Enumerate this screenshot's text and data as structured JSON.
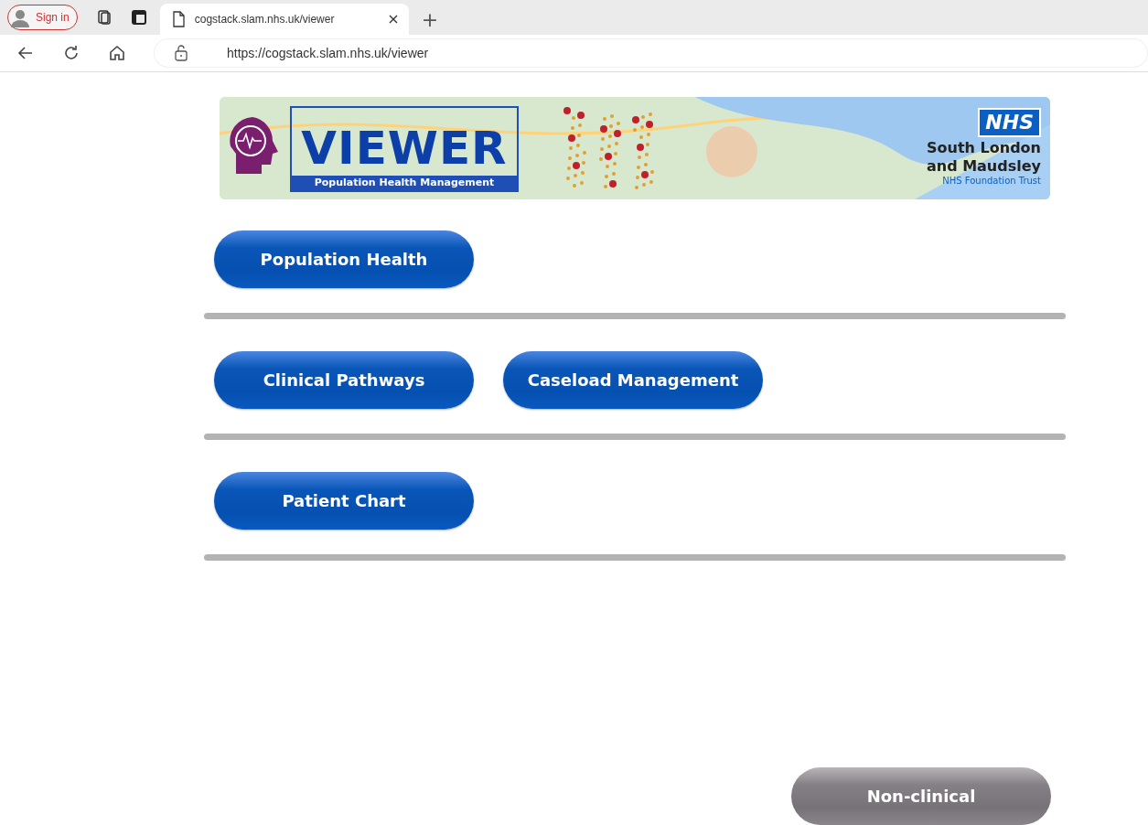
{
  "browser": {
    "profile": {
      "label": "Sign in"
    },
    "tabs": [
      {
        "title": "cogstack.slam.nhs.uk/viewer",
        "selected": true
      }
    ],
    "new_tab": "+",
    "url": "https://cogstack.slam.nhs.uk/viewer"
  },
  "banner": {
    "title": "VIEWER",
    "subtitle": "Population Health Management",
    "nhs_badge": "NHS",
    "trust_name": "South London and Maudsley",
    "trust_subtitle": "NHS Foundation Trust"
  },
  "sections": [
    {
      "buttons": [
        {
          "label": "Population Health",
          "kind": "primary"
        }
      ]
    },
    {
      "buttons": [
        {
          "label": "Clinical Pathways",
          "kind": "primary"
        },
        {
          "label": "Caseload Management",
          "kind": "primary"
        }
      ]
    },
    {
      "buttons": [
        {
          "label": "Patient Chart",
          "kind": "primary"
        }
      ]
    }
  ],
  "footer_button": {
    "label": "Non-clinical",
    "kind": "secondary"
  }
}
